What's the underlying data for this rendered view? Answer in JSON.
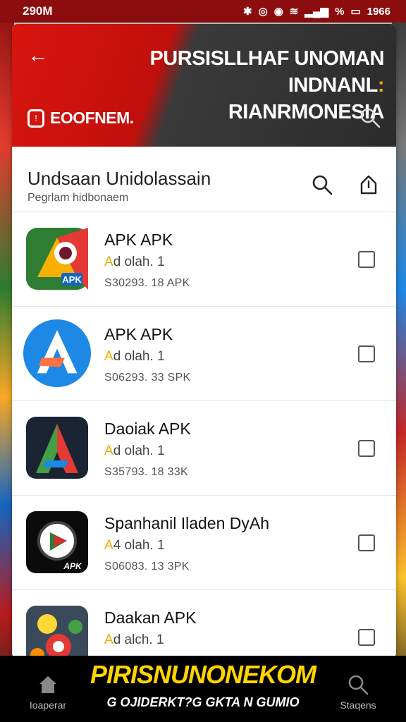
{
  "statusbar": {
    "time": "290M",
    "battery_text": "%",
    "clock_right": "1966"
  },
  "header": {
    "title_line1": "Pursisllhaf unoman indnanl",
    "title_line1_suffix": ":",
    "title_line2": "Rianrmonesia",
    "brand": "EOOFNEM.",
    "back_icon": "arrow-left-icon",
    "search_icon": "search-icon"
  },
  "section": {
    "title": "Undsaan Unidolassain",
    "subtitle": "Pegrlam hidbonaem",
    "search_icon": "search-icon",
    "share_icon": "share-icon"
  },
  "apps": [
    {
      "name": "APK APK",
      "rating_star": "A",
      "rating_text": "d olah. 1",
      "size": "S30293. 18 APK",
      "icon": "chrome-style-icon"
    },
    {
      "name": "APK APK",
      "rating_star": "A",
      "rating_text": "d olah. 1",
      "size": "S06293. 33 SPK",
      "icon": "app-store-icon"
    },
    {
      "name": "Daoiak APK",
      "rating_star": "A",
      "rating_text": "d olah. 1",
      "size": "S35793. 18 33K",
      "icon": "triangle-a-icon"
    },
    {
      "name": "Spanhanil Iladen DyAh",
      "rating_star": "A",
      "rating_text": "4 olah. 1",
      "size": "S06083. 13 3PK",
      "icon": "play-circle-icon"
    },
    {
      "name": "Daakan APK",
      "rating_star": "A",
      "rating_text": "d alch. 1",
      "size": "",
      "icon": "cartoon-icon"
    }
  ],
  "bottom": {
    "left_label": "Ioaperar",
    "right_label": "Staqens",
    "banner_title": "PIRISNUNONEKOM",
    "banner_sub": "G OJIDERKT?G GKTA N GUMIO"
  },
  "colors": {
    "header_red": "#d8150f",
    "banner_yellow": "#ffd400",
    "star": "#f2a900"
  }
}
